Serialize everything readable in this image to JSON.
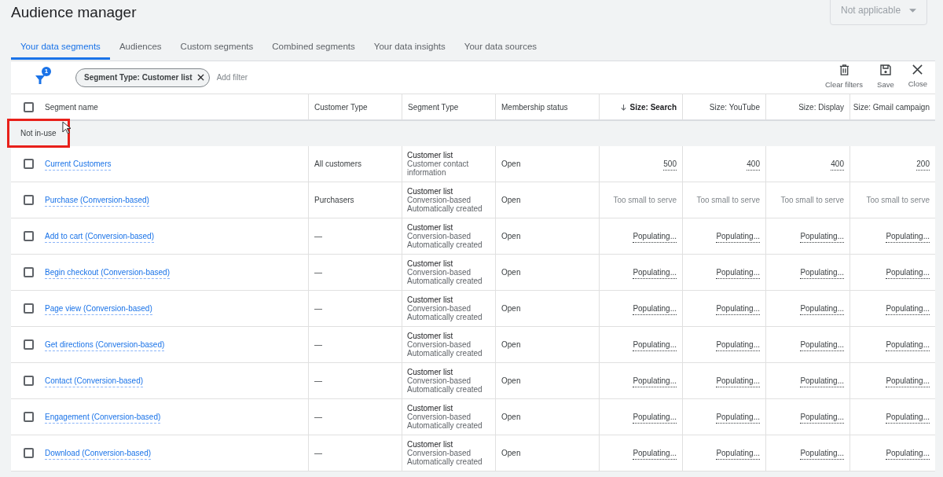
{
  "title": "Audience manager",
  "date_dropdown": {
    "value": "Not applicable",
    "disabled": true
  },
  "tabs": [
    {
      "label": "Your data segments",
      "selected": true
    },
    {
      "label": "Audiences",
      "selected": false
    },
    {
      "label": "Custom segments",
      "selected": false
    },
    {
      "label": "Combined segments",
      "selected": false
    },
    {
      "label": "Your data insights",
      "selected": false
    },
    {
      "label": "Your data sources",
      "selected": false
    }
  ],
  "toolbar": {
    "filter_badge": "1",
    "chips": [
      {
        "label": "Segment Type: Customer list"
      }
    ],
    "add_filter": "Add filter",
    "actions": [
      {
        "kind": "clear",
        "label": "Clear filters"
      },
      {
        "kind": "save",
        "label": "Save"
      },
      {
        "kind": "close",
        "label": "Close"
      }
    ]
  },
  "table": {
    "select_all_checked": false,
    "columns": [
      {
        "label": "Segment name",
        "sorted": false
      },
      {
        "label": "Customer Type",
        "sorted": false
      },
      {
        "label": "Segment Type",
        "sorted": false
      },
      {
        "label": "Membership status",
        "sorted": false
      },
      {
        "label": "Size: Search",
        "sorted": true
      },
      {
        "label": "Size: YouTube",
        "sorted": false
      },
      {
        "label": "Size: Display",
        "sorted": false
      },
      {
        "label": "Size: Gmail campaign",
        "sorted": false
      }
    ],
    "group": {
      "label": "Not in-use",
      "highlighted": true
    },
    "rows": [
      {
        "checked": false,
        "name": "Current Customers",
        "customer_type": "All customers",
        "segment_type": [
          "Customer list",
          "Customer contact information"
        ],
        "membership": "Open",
        "sizes": [
          {
            "text": "500",
            "dotted": true
          },
          {
            "text": "400",
            "dotted": true
          },
          {
            "text": "400",
            "dotted": true
          },
          {
            "text": "200",
            "dotted": true
          }
        ]
      },
      {
        "checked": false,
        "name": "Purchase (Conversion-based)",
        "customer_type": "Purchasers",
        "segment_type": [
          "Customer list",
          "Conversion-based",
          "Automatically created"
        ],
        "membership": "Open",
        "sizes": [
          {
            "text": "Too small to serve",
            "dotted": false
          },
          {
            "text": "Too small to serve",
            "dotted": false
          },
          {
            "text": "Too small to serve",
            "dotted": false
          },
          {
            "text": "Too small to serve",
            "dotted": false
          }
        ]
      },
      {
        "checked": false,
        "name": "Add to cart (Conversion-based)",
        "customer_type": "—",
        "segment_type": [
          "Customer list",
          "Conversion-based",
          "Automatically created"
        ],
        "membership": "Open",
        "sizes": [
          {
            "text": "Populating...",
            "dotted": true
          },
          {
            "text": "Populating...",
            "dotted": true
          },
          {
            "text": "Populating...",
            "dotted": true
          },
          {
            "text": "Populating...",
            "dotted": true
          }
        ]
      },
      {
        "checked": false,
        "name": "Begin checkout (Conversion-based)",
        "customer_type": "—",
        "segment_type": [
          "Customer list",
          "Conversion-based",
          "Automatically created"
        ],
        "membership": "Open",
        "sizes": [
          {
            "text": "Populating...",
            "dotted": true
          },
          {
            "text": "Populating...",
            "dotted": true
          },
          {
            "text": "Populating...",
            "dotted": true
          },
          {
            "text": "Populating...",
            "dotted": true
          }
        ]
      },
      {
        "checked": false,
        "name": "Page view (Conversion-based)",
        "customer_type": "—",
        "segment_type": [
          "Customer list",
          "Conversion-based",
          "Automatically created"
        ],
        "membership": "Open",
        "sizes": [
          {
            "text": "Populating...",
            "dotted": true
          },
          {
            "text": "Populating...",
            "dotted": true
          },
          {
            "text": "Populating...",
            "dotted": true
          },
          {
            "text": "Populating...",
            "dotted": true
          }
        ]
      },
      {
        "checked": false,
        "name": "Get directions (Conversion-based)",
        "customer_type": "—",
        "segment_type": [
          "Customer list",
          "Conversion-based",
          "Automatically created"
        ],
        "membership": "Open",
        "sizes": [
          {
            "text": "Populating...",
            "dotted": true
          },
          {
            "text": "Populating...",
            "dotted": true
          },
          {
            "text": "Populating...",
            "dotted": true
          },
          {
            "text": "Populating...",
            "dotted": true
          }
        ]
      },
      {
        "checked": false,
        "name": "Contact (Conversion-based)",
        "customer_type": "—",
        "segment_type": [
          "Customer list",
          "Conversion-based",
          "Automatically created"
        ],
        "membership": "Open",
        "sizes": [
          {
            "text": "Populating...",
            "dotted": true
          },
          {
            "text": "Populating...",
            "dotted": true
          },
          {
            "text": "Populating...",
            "dotted": true
          },
          {
            "text": "Populating...",
            "dotted": true
          }
        ]
      },
      {
        "checked": false,
        "name": "Engagement (Conversion-based)",
        "customer_type": "—",
        "segment_type": [
          "Customer list",
          "Conversion-based",
          "Automatically created"
        ],
        "membership": "Open",
        "sizes": [
          {
            "text": "Populating...",
            "dotted": true
          },
          {
            "text": "Populating...",
            "dotted": true
          },
          {
            "text": "Populating...",
            "dotted": true
          },
          {
            "text": "Populating...",
            "dotted": true
          }
        ]
      },
      {
        "checked": false,
        "name": "Download (Conversion-based)",
        "customer_type": "—",
        "segment_type": [
          "Customer list",
          "Conversion-based",
          "Automatically created"
        ],
        "membership": "Open",
        "sizes": [
          {
            "text": "Populating...",
            "dotted": true
          },
          {
            "text": "Populating...",
            "dotted": true
          },
          {
            "text": "Populating...",
            "dotted": true
          },
          {
            "text": "Populating...",
            "dotted": true
          }
        ]
      }
    ]
  }
}
